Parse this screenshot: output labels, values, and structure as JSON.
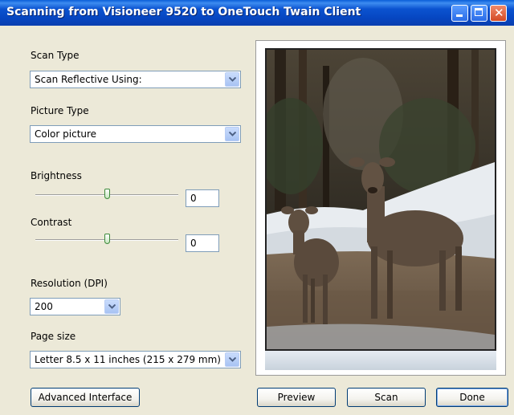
{
  "window": {
    "title": "Scanning from Visioneer 9520 to OneTouch Twain Client"
  },
  "icons": {
    "minimize": "minimize-icon",
    "maximize": "maximize-icon",
    "close": "close-icon",
    "dropdown": "chevron-down-icon",
    "close_glyph": "✕"
  },
  "scan_type": {
    "label": "Scan Type",
    "value": "Scan Reflective Using:"
  },
  "picture_type": {
    "label": "Picture Type",
    "value": "Color picture"
  },
  "brightness": {
    "label": "Brightness",
    "value": "0",
    "level": 0.5
  },
  "contrast": {
    "label": "Contrast",
    "value": "0",
    "level": 0.5
  },
  "resolution": {
    "label": "Resolution (DPI)",
    "value": "200"
  },
  "page_size": {
    "label": "Page size",
    "value": "Letter 8.5 x 11 inches (215 x 279 mm)"
  },
  "buttons": {
    "advanced": "Advanced Interface",
    "preview": "Preview",
    "scan": "Scan",
    "done": "Done"
  },
  "colors": {
    "titlebar": "#0b53d0",
    "window_bg": "#ece9d8",
    "field_border": "#7f9db9"
  }
}
